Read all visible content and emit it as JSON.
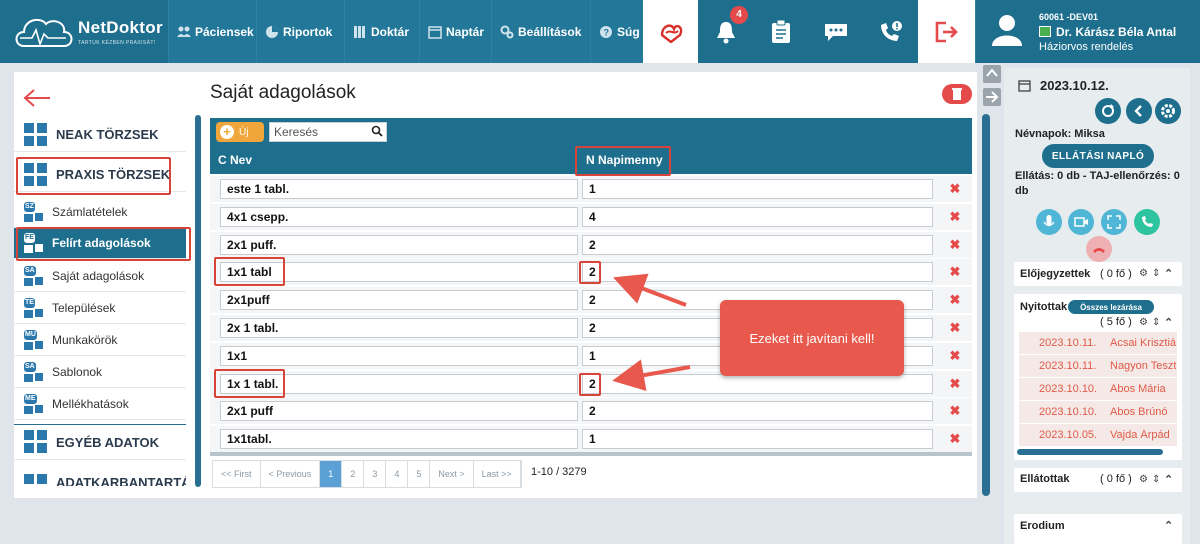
{
  "brand": {
    "name": "NetDoktor",
    "tagline": "TARTUK KÉZBEN PRAXISÁT!"
  },
  "nav": [
    {
      "label": "Páciensek",
      "icon": "users-icon"
    },
    {
      "label": "Riportok",
      "icon": "pie-chart-icon"
    },
    {
      "label": "Doktár",
      "icon": "books-icon"
    },
    {
      "label": "Naptár",
      "icon": "calendar-icon"
    },
    {
      "label": "Beállítások",
      "icon": "gears-icon"
    },
    {
      "label": "Súg",
      "icon": "help-icon"
    }
  ],
  "notifications": {
    "count": "4"
  },
  "user": {
    "id": "60061 -DEV01",
    "name": "Dr. Kárász Béla Antal",
    "role": "Háziorvos rendelés"
  },
  "sidebar": {
    "categories": [
      {
        "label": "NEAK TÖRZSEK"
      },
      {
        "label": "PRAXIS TÖRZSEK"
      },
      {
        "label": "EGYÉB ADATOK"
      },
      {
        "label": "ADATKARBANTARTÁS"
      }
    ],
    "items": [
      {
        "tag": "SZ",
        "label": "Számlatételek"
      },
      {
        "tag": "FE",
        "label": "Felírt adagolások"
      },
      {
        "tag": "SA",
        "label": "Saját adagolások"
      },
      {
        "tag": "TE",
        "label": "Települések"
      },
      {
        "tag": "MU",
        "label": "Munkakörök"
      },
      {
        "tag": "SA",
        "label": "Sablonok"
      },
      {
        "tag": "ME",
        "label": "Mellékhatások"
      }
    ]
  },
  "main": {
    "title": "Saját adagolások",
    "new_label": "Új",
    "search_placeholder": "Keresés",
    "columns": [
      "C Nev",
      "N Napimenny"
    ],
    "rows": [
      {
        "nev": "este 1 tabl.",
        "napi": "1"
      },
      {
        "nev": "4x1 csepp.",
        "napi": "4"
      },
      {
        "nev": "2x1 puff.",
        "napi": "2"
      },
      {
        "nev": "1x1 tabl",
        "napi": "2"
      },
      {
        "nev": "2x1puff",
        "napi": "2"
      },
      {
        "nev": "2x 1 tabl.",
        "napi": "2"
      },
      {
        "nev": "1x1",
        "napi": "1"
      },
      {
        "nev": "1x 1 tabl.",
        "napi": "2"
      },
      {
        "nev": "2x1 puff",
        "napi": "2"
      },
      {
        "nev": "1x1tabl.",
        "napi": "1"
      }
    ],
    "pager": [
      "<< First",
      "< Previous",
      "1",
      "2",
      "3",
      "4",
      "5",
      "Next >",
      "Last >>"
    ],
    "count": "1-10 / 3279",
    "callout": "Ezeket itt javítani kell!"
  },
  "right": {
    "date": "2023.10.12.",
    "nevnapok": "Névnapok: Miksa",
    "naplo_label": "ELLÁTÁSI NAPLÓ",
    "ellatas_line1": "Ellátás: 0 db - TAJ-ellenőrzés: 0",
    "ellatas_line2": "db",
    "elojegyzettek": "Előjegyzettek",
    "elojegyzettek_count": "( 0 fő )",
    "nyitottak": "Nyitottak",
    "osszes_lezarasa": "Összes lezárása",
    "nyitottak_count": "( 5 fő )",
    "patients": [
      {
        "date": "2023.10.11.",
        "name": "Acsai Krisztiá"
      },
      {
        "date": "2023.10.11.",
        "name": "Nagyon Teszt"
      },
      {
        "date": "2023.10.10.",
        "name": "Abos Mária"
      },
      {
        "date": "2023.10.10.",
        "name": "Abos Brúnó"
      },
      {
        "date": "2023.10.05.",
        "name": "Vajda Árpád"
      }
    ],
    "ellatottak": "Ellátottak",
    "ellatottak_count": "( 0 fő )",
    "erodium": "Erodium"
  },
  "colors": {
    "primary": "#1e6f8e",
    "accent": "#e44a4a",
    "warning": "#f0a63a",
    "page_active": "#5ba1d6"
  }
}
